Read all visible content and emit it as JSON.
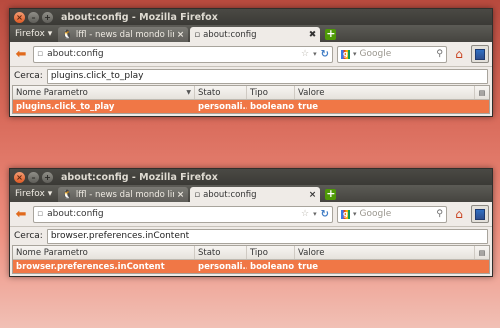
{
  "windows": [
    {
      "title": "about:config - Mozilla Firefox",
      "firefox_menu": "Firefox",
      "tabs": [
        {
          "label": "lffl - news dal mondo linux -...",
          "active": false
        },
        {
          "label": "about:config",
          "active": true
        }
      ],
      "url": "about:config",
      "search_placeholder": "Google",
      "filter_label": "Cerca:",
      "filter_value": "plugins.click_to_play",
      "columns": [
        "Nome Parametro",
        "Stato",
        "Tipo",
        "Valore"
      ],
      "rows": [
        {
          "name": "plugins.click_to_play",
          "state": "personali...",
          "type": "booleano",
          "value": "true"
        }
      ]
    },
    {
      "title": "about:config - Mozilla Firefox",
      "firefox_menu": "Firefox",
      "tabs": [
        {
          "label": "lffl - news dal mondo linux -...",
          "active": false
        },
        {
          "label": "about:config",
          "active": true
        }
      ],
      "url": "about:config",
      "search_placeholder": "Google",
      "filter_label": "Cerca:",
      "filter_value": "browser.preferences.inContent",
      "columns": [
        "Nome Parametro",
        "Stato",
        "Tipo",
        "Valore"
      ],
      "rows": [
        {
          "name": "browser.preferences.inContent",
          "state": "personali...",
          "type": "booleano",
          "value": "true"
        }
      ]
    }
  ],
  "colors": {
    "accent_row": "#f07746",
    "titlebar": "#3b3a36",
    "back_arrow": "#e06a1c"
  }
}
